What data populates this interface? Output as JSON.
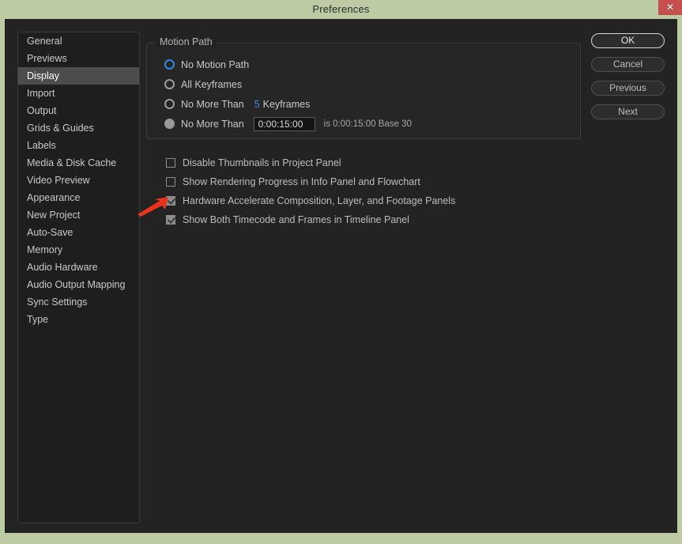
{
  "window": {
    "title": "Preferences",
    "close_label": "✕",
    "accent_blue": "#3a8fd8",
    "titlebar_color": "#bdcba4",
    "close_button_color": "#c5504e",
    "annotation_color": "#e8341c"
  },
  "sidebar": {
    "items": [
      {
        "label": "General",
        "selected": false
      },
      {
        "label": "Previews",
        "selected": false
      },
      {
        "label": "Display",
        "selected": true
      },
      {
        "label": "Import",
        "selected": false
      },
      {
        "label": "Output",
        "selected": false
      },
      {
        "label": "Grids & Guides",
        "selected": false
      },
      {
        "label": "Labels",
        "selected": false
      },
      {
        "label": "Media & Disk Cache",
        "selected": false
      },
      {
        "label": "Video Preview",
        "selected": false
      },
      {
        "label": "Appearance",
        "selected": false
      },
      {
        "label": "New Project",
        "selected": false
      },
      {
        "label": "Auto-Save",
        "selected": false
      },
      {
        "label": "Memory",
        "selected": false
      },
      {
        "label": "Audio Hardware",
        "selected": false
      },
      {
        "label": "Audio Output Mapping",
        "selected": false
      },
      {
        "label": "Sync Settings",
        "selected": false
      },
      {
        "label": "Type",
        "selected": false
      }
    ]
  },
  "motion_path": {
    "group_title": "Motion Path",
    "options": [
      {
        "label": "No Motion Path",
        "selected": true,
        "style": "ring"
      },
      {
        "label": "All Keyframes",
        "selected": false,
        "style": "ring"
      },
      {
        "label": "No More Than",
        "selected": false,
        "style": "ring",
        "value": "5",
        "value_suffix": "Keyframes"
      },
      {
        "label": "No More Than",
        "selected": false,
        "style": "disc",
        "timecode": "0:00:15:00",
        "suffix": "is 0:00:15:00  Base 30"
      }
    ]
  },
  "checkboxes": [
    {
      "label": "Disable Thumbnails in Project Panel",
      "checked": false
    },
    {
      "label": "Show Rendering Progress in Info Panel and Flowchart",
      "checked": false
    },
    {
      "label": "Hardware Accelerate Composition, Layer, and Footage Panels",
      "checked": true
    },
    {
      "label": "Show Both Timecode and Frames in Timeline Panel",
      "checked": true
    }
  ],
  "buttons": [
    {
      "label": "OK",
      "primary": true
    },
    {
      "label": "Cancel",
      "primary": false
    },
    {
      "label": "Previous",
      "primary": false
    },
    {
      "label": "Next",
      "primary": false
    }
  ]
}
